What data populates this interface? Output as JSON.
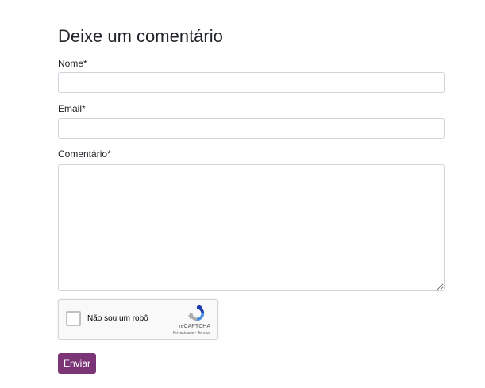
{
  "form": {
    "title": "Deixe um comentário",
    "name_label": "Nome*",
    "name_value": "",
    "email_label": "Email*",
    "email_value": "",
    "comment_label": "Comentário*",
    "comment_value": "",
    "submit_label": "Enviar"
  },
  "recaptcha": {
    "label": "Não sou um robô",
    "brand": "reCAPTCHA",
    "privacy_link": "Privacidade",
    "separator": " - ",
    "terms_link": "Termos",
    "checked": false
  },
  "colors": {
    "accent": "#7b3576",
    "border": "#ced4da",
    "text": "#212529"
  },
  "icons": {
    "recaptcha_logo": "recaptcha-logo-icon"
  }
}
